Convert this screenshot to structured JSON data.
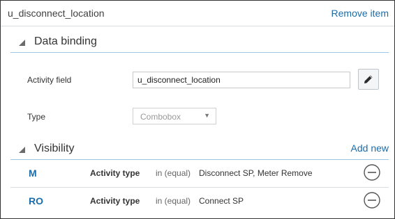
{
  "header": {
    "item_title": "u_disconnect_location",
    "remove_label": "Remove item"
  },
  "data_binding": {
    "section_title": "Data binding",
    "activity_field_label": "Activity field",
    "activity_field_value": "u_disconnect_location",
    "edit_icon": "pencil-icon",
    "type_label": "Type",
    "type_selected": "Combobox",
    "type_caret": "▼"
  },
  "visibility": {
    "section_title": "Visibility",
    "add_label": "Add new",
    "rows": [
      {
        "code": "M",
        "field": "Activity type",
        "condition": "in (equal)",
        "values": "Disconnect SP, Meter Remove",
        "action_icon": "minus-circle-icon"
      },
      {
        "code": "RO",
        "field": "Activity type",
        "condition": "in (equal)",
        "values": "Connect SP",
        "action_icon": "minus-circle-icon"
      }
    ]
  },
  "colors": {
    "link": "#1c6ca9",
    "section_divider": "#9cc6e3",
    "row_divider": "#d6dee3",
    "border": "#333333"
  }
}
